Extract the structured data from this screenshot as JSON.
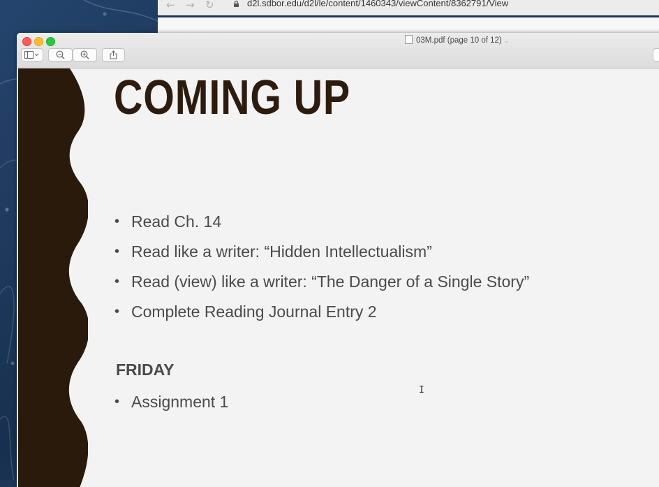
{
  "browser": {
    "back_icon": "←",
    "forward_icon": "→",
    "reload_icon": "↻",
    "url": "d2l.sdbor.edu/d2l/le/content/1460343/viewContent/8362791/View"
  },
  "preview": {
    "title": "03M.pdf (page 10 of 12)",
    "title_chevron": "⌄"
  },
  "slide": {
    "heading": "COMING UP",
    "bullet_symbol": "•",
    "bullets": [
      "Read Ch. 14",
      "Read like a writer: “Hidden Intellectualism”",
      "Read (view) like a writer: “The Danger of a Single Story”",
      "Complete Reading Journal Entry 2"
    ],
    "section_label": "FRIDAY",
    "section_bullets": [
      "Assignment 1"
    ],
    "wave_color": "#2a1a0c",
    "text_color": "#4a4a4a"
  },
  "cursor": "I"
}
